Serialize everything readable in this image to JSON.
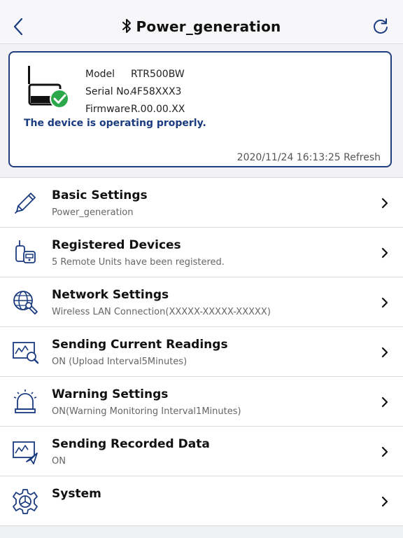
{
  "header": {
    "title": "Power_generation",
    "back_icon": "chevron-left-icon",
    "bluetooth_icon": "bluetooth-icon",
    "refresh_icon": "refresh-icon"
  },
  "device": {
    "model_label": "Model",
    "model_value": "RTR500BW",
    "serial_label": "Serial No.",
    "serial_value": "4F58XXX3",
    "firmware_label": "Firmware",
    "firmware_value": "R.00.00.XX",
    "status": "The device is operating properly.",
    "timestamp": "2020/11/24 16:13:25 Refresh"
  },
  "menu": [
    {
      "label": "Basic Settings",
      "sub": "Power_generation",
      "icon": "pencil-icon"
    },
    {
      "label": "Registered Devices",
      "sub": "5 Remote Units have been registered.",
      "icon": "devices-icon"
    },
    {
      "label": "Network Settings",
      "sub": "Wireless LAN Connection(XXXXX-XXXXX-XXXXX)",
      "icon": "globe-wrench-icon"
    },
    {
      "label": "Sending Current Readings",
      "sub": "ON (Upload Interval5Minutes)",
      "icon": "chart-search-icon"
    },
    {
      "label": "Warning Settings",
      "sub": "ON(Warning Monitoring Interval1Minutes)",
      "icon": "alarm-light-icon"
    },
    {
      "label": "Sending Recorded Data",
      "sub": "ON",
      "icon": "chart-send-icon"
    },
    {
      "label": "System",
      "sub": "",
      "icon": "gear-icon"
    }
  ],
  "colors": {
    "accent": "#1f3f7f",
    "success": "#2aa84a"
  }
}
